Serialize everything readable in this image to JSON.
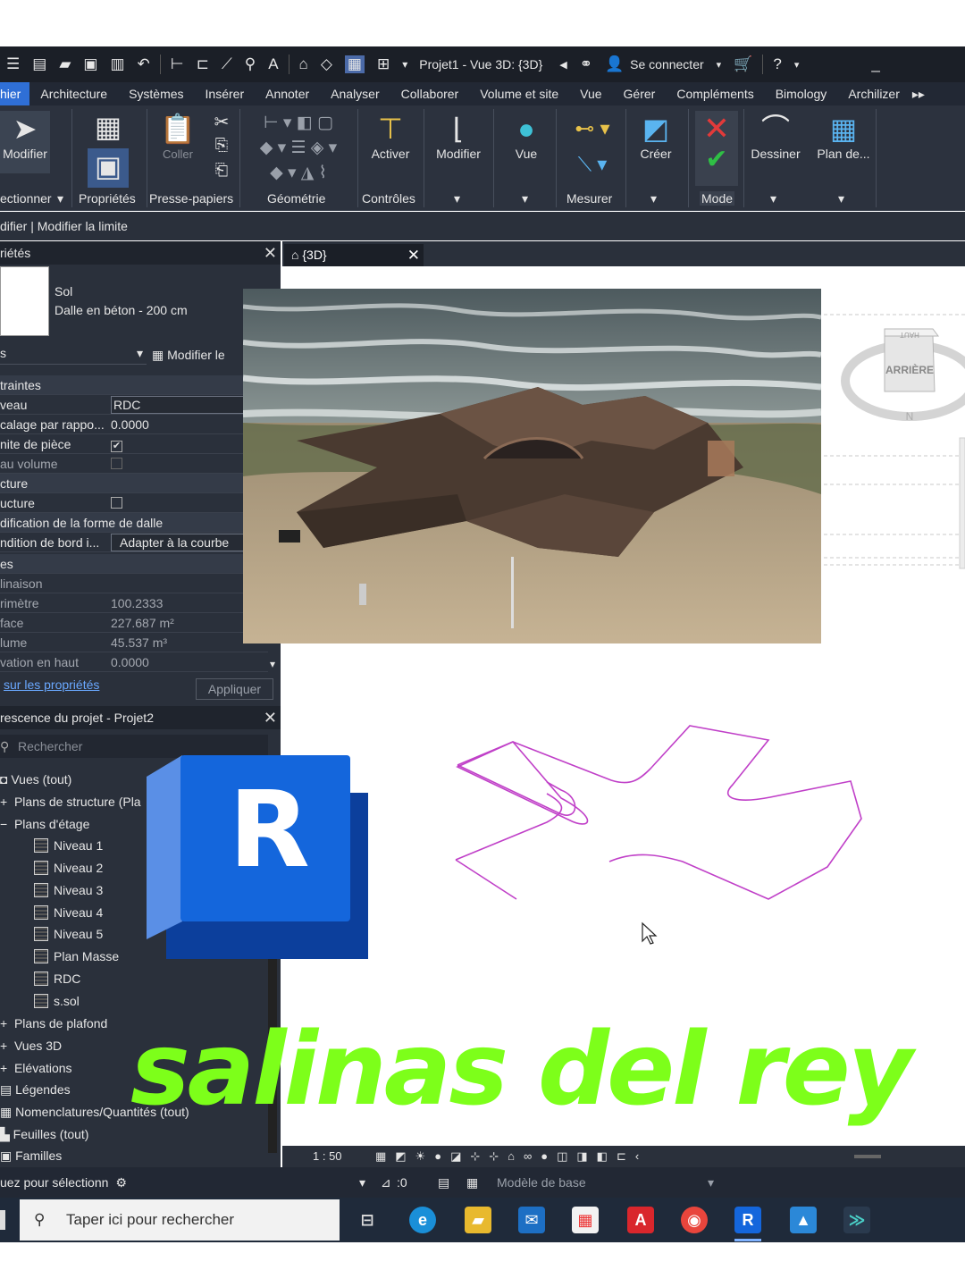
{
  "qat": {
    "title": "Projet1 - Vue 3D: {3D}",
    "connect_label": "Se connecter"
  },
  "tabs": [
    "hier",
    "Architecture",
    "Systèmes",
    "Insérer",
    "Annoter",
    "Analyser",
    "Collaborer",
    "Volume et site",
    "Vue",
    "Gérer",
    "Compléments",
    "Bimology",
    "Archilizer"
  ],
  "ribbon": {
    "modifier": "Modifier",
    "coller": "Coller",
    "activer": "Activer",
    "modifier2": "Modifier",
    "vue": "Vue",
    "creer": "Créer",
    "dessiner": "Dessiner",
    "plan": "Plan de...",
    "panels": {
      "selectionner": "ectionner",
      "proprietes": "Propriétés",
      "presse_papiers": "Presse-papiers",
      "geometrie": "Géométrie",
      "controles": "Contrôles",
      "mesurer": "Mesurer",
      "mode": "Mode"
    }
  },
  "options_bar": "difier | Modifier la limite",
  "properties": {
    "header": "riétés",
    "type_family": "Sol",
    "type_name": "Dalle en béton - 200 cm",
    "selector": "s",
    "edit_type": "Modifier le",
    "rows": {
      "g1": "traintes",
      "niveau_k": "veau",
      "niveau_v": "RDC",
      "decal_k": "calage par rappo...",
      "decal_v": "0.0000",
      "limite_k": "nite de pièce",
      "volume_k": "au volume",
      "g2": "cture",
      "structure_k": "ucture",
      "g3": "dification de la forme de dalle",
      "bord_k": "ndition de bord i...",
      "bord_v": "Adapter à la courbe",
      "g4": "es",
      "incl_k": "linaison",
      "perim_k": "rimètre",
      "perim_v": "100.2333",
      "surf_k": "face",
      "surf_v": "227.687 m²",
      "vol_k": "lume",
      "vol_v": "45.537 m³",
      "elev_k": "vation en haut",
      "elev_v": "0.0000"
    },
    "help_link": "sur les propriétés",
    "apply": "Appliquer"
  },
  "browser": {
    "header": "rescence du projet - Projet2",
    "search_placeholder": "Rechercher",
    "items": {
      "vues": "Vues (tout)",
      "structure": "Plans de structure (Pla",
      "etage": "Plans d'étage",
      "n1": "Niveau 1",
      "n2": "Niveau 2",
      "n3": "Niveau 3",
      "n4": "Niveau 4",
      "n5": "Niveau 5",
      "masse": "Plan Masse",
      "rdc": "RDC",
      "ssol": "s.sol",
      "plafond": "Plans de plafond",
      "vues3d": "Vues 3D",
      "elev": "Elévations",
      "legendes": "Légendes",
      "nomencl": "Nomenclatures/Quantités (tout)",
      "feuilles": "Feuilles (tout)",
      "familles": "Familles"
    }
  },
  "view": {
    "tab": "{3D}",
    "cube_label": "ARRIÈRE",
    "cube_top": "HAUT",
    "compass": "N",
    "scale": "1 : 50"
  },
  "status": {
    "left": "uez pour sélectionn",
    "count": ":0",
    "model": "Modèle de base"
  },
  "taskbar": {
    "search": "Taper ici pour rechercher"
  },
  "logo_letter": "R",
  "caption": "salinas del rey",
  "colors": {
    "accent": "#2f6fd6",
    "caption": "#7dff1a",
    "sketch": "#c040c8",
    "logo_main": "#1466dc",
    "logo_dark": "#0c3f9c"
  }
}
